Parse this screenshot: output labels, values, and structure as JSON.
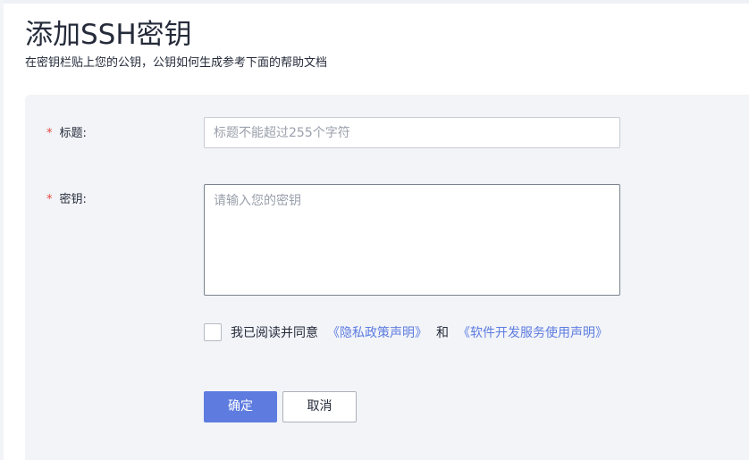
{
  "page": {
    "title": "添加SSH密钥",
    "subtitle": "在密钥栏贴上您的公钥，公钥如何生成参考下面的帮助文档"
  },
  "form": {
    "title_field": {
      "required_mark": "*",
      "label": "标题:",
      "value": "",
      "placeholder": "标题不能超过255个字符"
    },
    "key_field": {
      "required_mark": "*",
      "label": "密钥:",
      "value": "",
      "placeholder": "请输入您的密钥"
    },
    "agreement": {
      "checked": false,
      "prefix": "我已阅读并同意",
      "privacy_link": "《隐私政策声明》",
      "conjunction": "和",
      "service_link": "《软件开发服务使用声明》"
    },
    "buttons": {
      "confirm": "确定",
      "cancel": "取消"
    }
  },
  "colors": {
    "primary": "#5e7ce0",
    "required": "#e5473d",
    "panel_background": "#f2f4f8"
  }
}
